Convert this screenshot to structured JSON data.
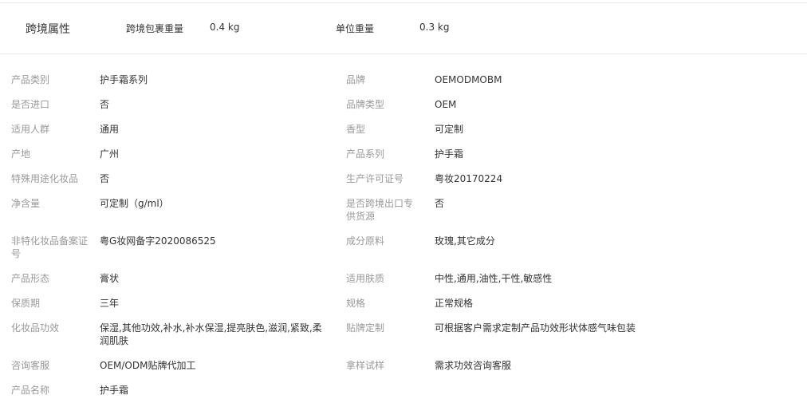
{
  "cross_border": {
    "title": "跨境属性",
    "package_weight_label": "跨境包裹重量",
    "package_weight_value": "0.4 kg",
    "unit_weight_label": "单位重量",
    "unit_weight_value": "0.3 kg"
  },
  "attributes": {
    "rows": [
      [
        {
          "label": "产品类别",
          "value": "护手霜系列"
        },
        {
          "label": "品牌",
          "value": "OEMODMOBM"
        }
      ],
      [
        {
          "label": "是否进口",
          "value": "否"
        },
        {
          "label": "品牌类型",
          "value": "OEM"
        }
      ],
      [
        {
          "label": "适用人群",
          "value": "通用"
        },
        {
          "label": "香型",
          "value": "可定制"
        }
      ],
      [
        {
          "label": "产地",
          "value": "广州"
        },
        {
          "label": "产品系列",
          "value": "护手霜"
        }
      ],
      [
        {
          "label": "特殊用途化妆品",
          "value": "否"
        },
        {
          "label": "生产许可证号",
          "value": "粤妆20170224"
        }
      ],
      [
        {
          "label": "净含量",
          "value": "可定制（g/ml）"
        },
        {
          "label": "是否跨境出口专供货源",
          "value": "否"
        }
      ],
      [
        {
          "label": "非特化妆品备案证号",
          "value": "粤G妆网备字2020086525"
        },
        {
          "label": "成分原料",
          "value": "玫瑰,其它成分"
        }
      ],
      [
        {
          "label": "产品形态",
          "value": "膏状"
        },
        {
          "label": "适用肤质",
          "value": "中性,通用,油性,干性,敏感性"
        }
      ],
      [
        {
          "label": "保质期",
          "value": "三年"
        },
        {
          "label": "规格",
          "value": "正常规格"
        }
      ],
      [
        {
          "label": "化妆品功效",
          "value": "保湿,其他功效,补水,补水保湿,提亮肤色,滋润,紧致,柔润肌肤"
        },
        {
          "label": "贴牌定制",
          "value": "可根据客户需求定制产品功效形状体感气味包装"
        }
      ],
      [
        {
          "label": "咨询客服",
          "value": "OEM/ODM贴牌代加工"
        },
        {
          "label": "拿样试样",
          "value": "需求功效咨询客服"
        }
      ],
      [
        {
          "label": "产品名称",
          "value": "护手霜"
        },
        null
      ]
    ]
  }
}
